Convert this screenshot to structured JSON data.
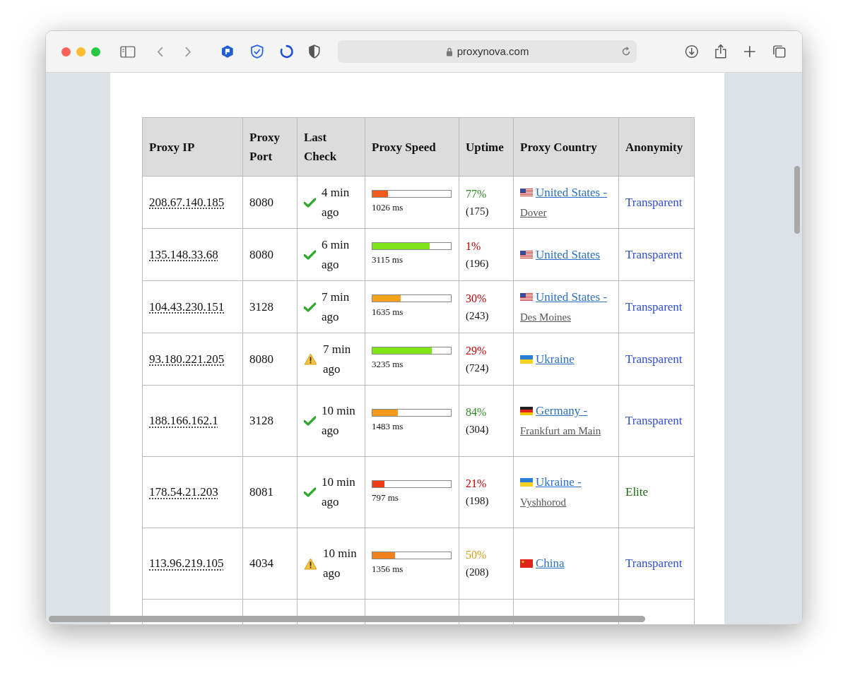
{
  "browser": {
    "url": "proxynova.com"
  },
  "table": {
    "columns": [
      "Proxy IP",
      "Proxy Port",
      "Last Check",
      "Proxy Speed",
      "Uptime",
      "Proxy Country",
      "Anonymity"
    ],
    "rows": [
      {
        "ip": "208.67.140.185",
        "port": "8080",
        "check": {
          "kind": "ok",
          "text": "4 min ago"
        },
        "speed": {
          "level": 0.2,
          "color": "#f05a1e",
          "reading": "1026 ms"
        },
        "uptime": {
          "percent": "77%",
          "count": "(175)",
          "color": "#2e8b22"
        },
        "country": {
          "kind": "us",
          "name": "United States -",
          "city": "Dover"
        },
        "anonymity": {
          "label": "Transparent",
          "color": "#2f4fd8"
        }
      },
      {
        "ip": "135.148.33.68",
        "port": "8080",
        "check": {
          "kind": "ok",
          "text": "6 min ago"
        },
        "speed": {
          "level": 0.73,
          "color": "#80e619",
          "reading": "3115 ms"
        },
        "uptime": {
          "percent": "1%",
          "count": "(196)",
          "color": "#c00000"
        },
        "country": {
          "kind": "us",
          "name": "United States"
        },
        "anonymity": {
          "label": "Transparent",
          "color": "#2f4fd8"
        }
      },
      {
        "ip": "104.43.230.151",
        "port": "3128",
        "check": {
          "kind": "ok",
          "text": "7 min ago"
        },
        "speed": {
          "level": 0.36,
          "color": "#f5a31a",
          "reading": "1635 ms"
        },
        "uptime": {
          "percent": "30%",
          "count": "(243)",
          "color": "#c00000"
        },
        "country": {
          "kind": "us",
          "name": "United States -",
          "city": "Des Moines"
        },
        "anonymity": {
          "label": "Transparent",
          "color": "#2f4fd8"
        }
      },
      {
        "ip": "93.180.221.205",
        "port": "8080",
        "check": {
          "kind": "warning",
          "text": "7 min ago"
        },
        "speed": {
          "level": 0.76,
          "color": "#80e619",
          "reading": "3235 ms"
        },
        "uptime": {
          "percent": "29%",
          "count": "(724)",
          "color": "#c00000"
        },
        "country": {
          "kind": "ua",
          "name": "Ukraine"
        },
        "anonymity": {
          "label": "Transparent",
          "color": "#2f4fd8"
        }
      },
      {
        "ip": "188.166.162.1",
        "port": "3128",
        "check": {
          "kind": "ok",
          "text": "10 min ago"
        },
        "speed": {
          "level": 0.32,
          "color": "#f59a1a",
          "reading": "1483 ms"
        },
        "uptime": {
          "percent": "84%",
          "count": "(304)",
          "color": "#2e8b22"
        },
        "country": {
          "kind": "de",
          "name": "Germany -",
          "city": "Frankfurt am Main"
        },
        "anonymity": {
          "label": "Transparent",
          "color": "#2f4fd8"
        }
      },
      {
        "ip": "178.54.21.203",
        "port": "8081",
        "check": {
          "kind": "ok",
          "text": "10 min ago"
        },
        "speed": {
          "level": 0.15,
          "color": "#f03c14",
          "reading": "797 ms"
        },
        "uptime": {
          "percent": "21%",
          "count": "(198)",
          "color": "#c00000"
        },
        "country": {
          "kind": "ua",
          "name": "Ukraine -",
          "city": "Vyshhorod"
        },
        "anonymity": {
          "label": "Elite",
          "color": "#1a6b10"
        }
      },
      {
        "ip": "113.96.219.105",
        "port": "4034",
        "check": {
          "kind": "warning",
          "text": "10 min ago"
        },
        "speed": {
          "level": 0.29,
          "color": "#f0821e",
          "reading": "1356 ms"
        },
        "uptime": {
          "percent": "50%",
          "count": "(208)",
          "color": "#d4a017"
        },
        "country": {
          "kind": "cn",
          "name": "China"
        },
        "anonymity": {
          "label": "Transparent",
          "color": "#2f4fd8"
        }
      }
    ]
  }
}
